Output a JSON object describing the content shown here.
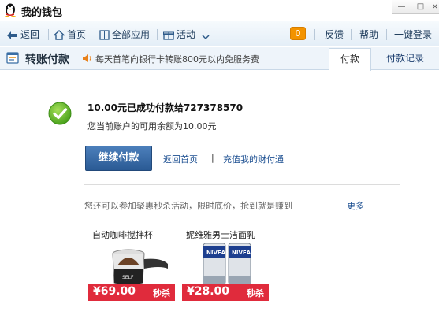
{
  "window": {
    "title": "我的钱包"
  },
  "nav": {
    "back": "返回",
    "home": "首页",
    "all_apps": "全部应用",
    "activity": "活动",
    "badge_count": "0",
    "feedback": "反馈",
    "help": "帮助",
    "login": "一键登录"
  },
  "header": {
    "page_title": "转账付款",
    "notice": "每天首笔向银行卡转账800元以内免服务费",
    "tabs": [
      "付款",
      "付款记录"
    ]
  },
  "result": {
    "title": "10.00元已成功付款给727378570",
    "balance": "您当前账户的可用余额为10.00元"
  },
  "actions": {
    "continue": "继续付款",
    "back_home": "返回首页",
    "separator": "|",
    "recharge": "充值我的财付通"
  },
  "promo": {
    "text": "您还可以参加聚惠秒杀活动，限时底价，抢到就是赚到",
    "more": "更多",
    "products": [
      {
        "name": "自动咖啡搅拌杯",
        "price": "¥69.00",
        "tag": "秒杀"
      },
      {
        "name": "妮维雅男士洁面乳",
        "price": "¥28.00",
        "tag": "秒杀"
      }
    ]
  },
  "colors": {
    "accent_blue": "#2a5a94",
    "price_red": "#e02b3c",
    "success_green": "#6cbf2b",
    "badge_orange": "#f39300"
  }
}
